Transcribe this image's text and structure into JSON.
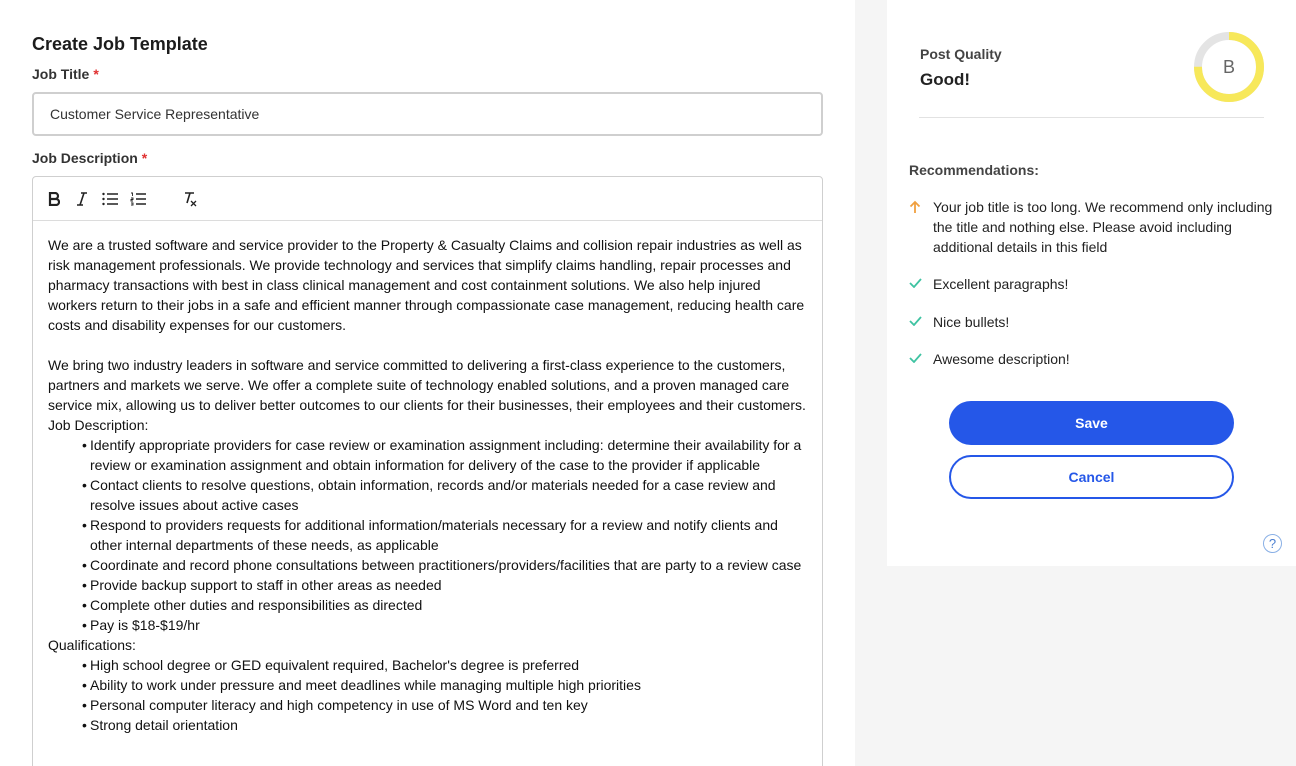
{
  "form": {
    "title": "Create Job Template",
    "job_title_label": "Job Title",
    "job_title_value": "Customer Service Representative",
    "job_desc_label": "Job Description",
    "required_mark": "*"
  },
  "toolbar": {
    "icons": [
      "bold-icon",
      "italic-icon",
      "bullet-list-icon",
      "numbered-list-icon",
      "clear-formatting-icon"
    ]
  },
  "description": {
    "para1": "We are a trusted software and service provider to the Property & Casualty Claims and collision repair industries as well as risk management professionals. We provide technology and services that simplify claims handling, repair processes and pharmacy transactions with best in class clinical management and cost containment solutions. We also help injured workers return to their jobs in a safe and efficient manner through compassionate case management, reducing health care costs and disability expenses for our customers.",
    "para2": "We bring two industry leaders in software and service committed to delivering a first-class experience to the customers, partners and markets we serve. We offer a complete suite of technology enabled solutions, and a proven managed care service mix, allowing us to deliver better outcomes to our clients for their businesses, their employees and their customers.",
    "jd_heading": "Job Description:",
    "jd_items": [
      "Identify appropriate providers for case review or examination assignment including: determine their availability for a review or examination assignment and obtain information for delivery of the case to the provider if applicable",
      "Contact clients to resolve questions, obtain information, records and/or materials needed for a case review and resolve issues about active cases",
      "Respond to providers requests for additional information/materials necessary for a review and notify clients and other internal departments of these needs, as applicable",
      "Coordinate and record phone consultations between practitioners/providers/facilities that are party to a review case",
      "Provide backup support to staff in other areas as needed",
      "Complete other duties and responsibilities as directed",
      "Pay is $18-$19/hr"
    ],
    "qual_heading": "Qualifications:",
    "qual_items": [
      "High school degree or GED equivalent required, Bachelor's degree is preferred",
      "Ability to work under pressure and meet deadlines while managing multiple high priorities",
      "Personal computer literacy and high competency in use of MS Word and ten key",
      "Strong detail orientation"
    ]
  },
  "quality": {
    "label": "Post Quality",
    "value": "Good!",
    "grade": "B",
    "score_fraction": 0.75,
    "colors": {
      "track": "#e4e4e4",
      "fill": "#f7e85a"
    }
  },
  "recommendations": {
    "title": "Recommendations:",
    "items": [
      {
        "icon": "arrow-up-icon",
        "text": "Your job title is too long. We recommend only including the title and nothing else. Please avoid including additional details in this field"
      },
      {
        "icon": "check-icon",
        "text": "Excellent paragraphs!"
      },
      {
        "icon": "check-icon",
        "text": "Nice bullets!"
      },
      {
        "icon": "check-icon",
        "text": "Awesome description!"
      }
    ]
  },
  "actions": {
    "save_label": "Save",
    "cancel_label": "Cancel",
    "help_label": "?"
  },
  "colors": {
    "primary": "#2557e8",
    "required": "#e03131",
    "warning": "#f0a040",
    "success": "#3fc3a2"
  }
}
